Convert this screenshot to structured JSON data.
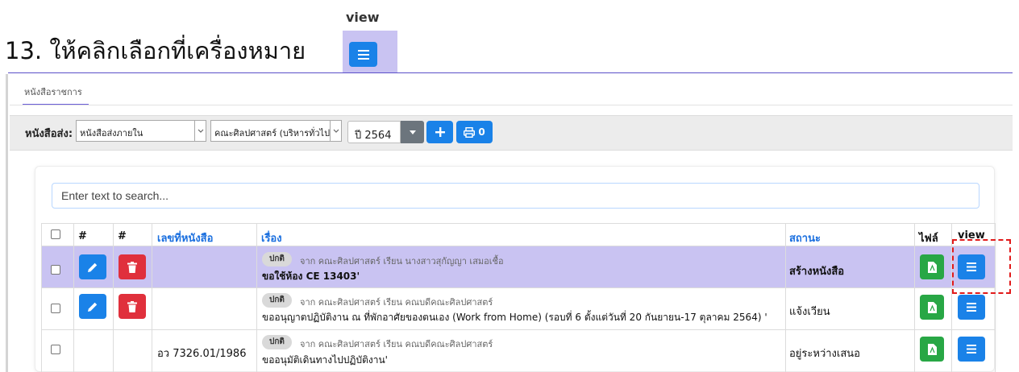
{
  "instruction": {
    "text": "13. ให้คลิกเลือกที่เครื่องหมาย",
    "zoom_column_label": "view"
  },
  "tabs": [
    {
      "label": "หนังสือราชการ"
    }
  ],
  "filter": {
    "label": "หนังสือส่ง:",
    "type_select": "หนังสือส่งภายใน",
    "org_select": "คณะศิลปศาสตร์ (บริหารทั่วไป)",
    "year": "ปี 2564",
    "print_count": "0"
  },
  "search": {
    "placeholder": "Enter text to search..."
  },
  "table": {
    "headers": [
      "#",
      "#",
      "เลขที่หนังสือ",
      "เรื่อง",
      "สถานะ",
      "ไฟล์",
      "view"
    ],
    "rows": [
      {
        "doc_no": "",
        "badge": "ปกติ",
        "from": "จาก คณะศิลปศาสตร์ เรียน นางสาวสุกัญญา เสมอเชื้อ",
        "title": "ขอใช้ห้อง CE 13403'",
        "status": "สร้างหนังสือ",
        "highlighted": true,
        "editable": true
      },
      {
        "doc_no": "",
        "badge": "ปกติ",
        "from": "จาก คณะศิลปศาสตร์ เรียน คณบดีคณะศิลปศาสตร์",
        "title": "ขออนุญาตปฏิบัติงาน ณ ที่พักอาศัยของตนเอง (Work from Home) (รอบที่ 6 ตั้งแต่วันที่ 20 กันยายน-17 ตุลาคม 2564) '",
        "status": "แจ้งเวียน",
        "highlighted": false,
        "editable": true
      },
      {
        "doc_no": "อว 7326.01/1986",
        "badge": "ปกติ",
        "from": "จาก คณะศิลปศาสตร์ เรียน คณบดีคณะศิลปศาสตร์",
        "title": "ขออนุมัติเดินทางไปปฏิบัติงาน'",
        "status": "อยู่ระหว่างเสนอ",
        "highlighted": false,
        "editable": false
      }
    ]
  },
  "colors": {
    "accent": "#1a82e8",
    "danger": "#e0303c",
    "success": "#28a745",
    "highlight": "#c9c3f2",
    "callout": "#e11a1a"
  }
}
